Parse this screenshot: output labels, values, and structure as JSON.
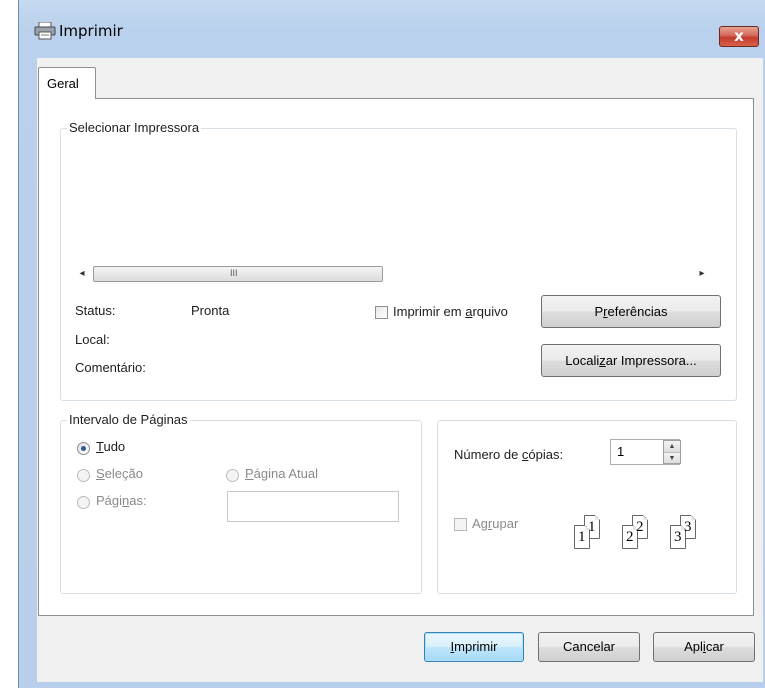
{
  "window": {
    "title": "Imprimir",
    "close_glyph": "x"
  },
  "tabs": [
    {
      "label": "Geral"
    }
  ],
  "printer_group": {
    "label": "Selecionar Impressora",
    "status_label": "Status:",
    "status_value": "Pronta",
    "location_label": "Local:",
    "comment_label": "Comentário:",
    "print_to_file": {
      "pre": "Imprimir em ",
      "accel": "a",
      "post": "rquivo",
      "checked": false
    },
    "preferences_button": {
      "pre": "P",
      "accel": "r",
      "post": "eferências"
    },
    "find_printer_button": {
      "pre": "Locali",
      "accel": "z",
      "post": "ar Impressora..."
    },
    "scroll": {
      "left_arrow": "◂",
      "right_arrow": "▸",
      "grip": "III"
    }
  },
  "page_range": {
    "label": "Intervalo de Páginas",
    "all": {
      "pre": "",
      "accel": "T",
      "post": "udo",
      "checked": true
    },
    "selection": {
      "pre": "",
      "accel": "S",
      "post": "eleção",
      "enabled": false
    },
    "current_page": {
      "pre": "",
      "accel": "P",
      "post": "ágina Atual",
      "enabled": false
    },
    "pages": {
      "pre": "Pági",
      "accel": "n",
      "post": "as:",
      "enabled": false,
      "value": ""
    }
  },
  "copies": {
    "label_pre": "Número de ",
    "label_accel": "c",
    "label_post": "ópias:",
    "value": "1",
    "collate": {
      "pre": "Ag",
      "accel": "r",
      "post": "upar",
      "checked": false,
      "enabled": false
    },
    "collate_numbers": [
      "1",
      "1",
      "2",
      "2",
      "3",
      "3"
    ]
  },
  "buttons": {
    "print": {
      "pre": "",
      "accel": "I",
      "post": "mprimir"
    },
    "cancel": "Cancelar",
    "apply": {
      "pre": "Apl",
      "accel": "i",
      "post": "car"
    }
  },
  "icons": {
    "app": "printer-icon",
    "close": "close-icon"
  },
  "colors": {
    "titlebar": "#c6daf0",
    "close": "#c23b2a",
    "default_button_border": "#3c7fb1"
  }
}
